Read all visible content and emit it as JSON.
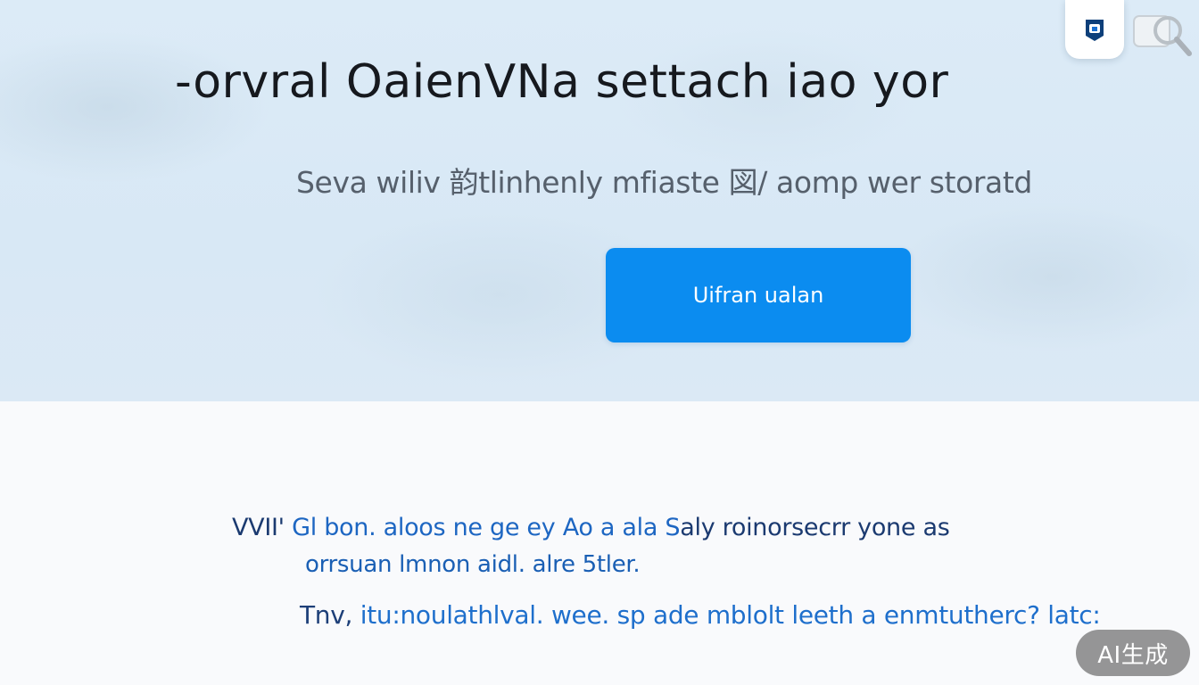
{
  "hero": {
    "title": "-orvral  OaienVNa settach iao yor",
    "subtitle": "Seva wiliv 韵tlinhenly mfiaste 図/ aomp wer storatd",
    "cta_label": "Uifran ualan"
  },
  "toolbar": {
    "app_icon": "app-logo-icon",
    "search_icon": "search-icon"
  },
  "content": {
    "paragraph_1_lead": "VVII'",
    "paragraph_1_a": "Gl bon. aloos ne ge ey",
    "paragraph_1_b": "Ao a ala S",
    "paragraph_1_c": "aly roinorsecrr yone as",
    "paragraph_2": "orrsuan lmnon aidl. alre 5tler.",
    "paragraph_3_lead": "Tnv,",
    "paragraph_3_a": "itu:noulathlval. wee. sp ade  mblolt leeth a",
    "paragraph_3_b": "enmtutherc? latc:"
  },
  "badge": {
    "label": "AI生成"
  },
  "colors": {
    "accent": "#0b8cf0",
    "hero_background": "#dcebf7",
    "text_dark": "#16191e",
    "link_blue": "#1a5fb4"
  }
}
